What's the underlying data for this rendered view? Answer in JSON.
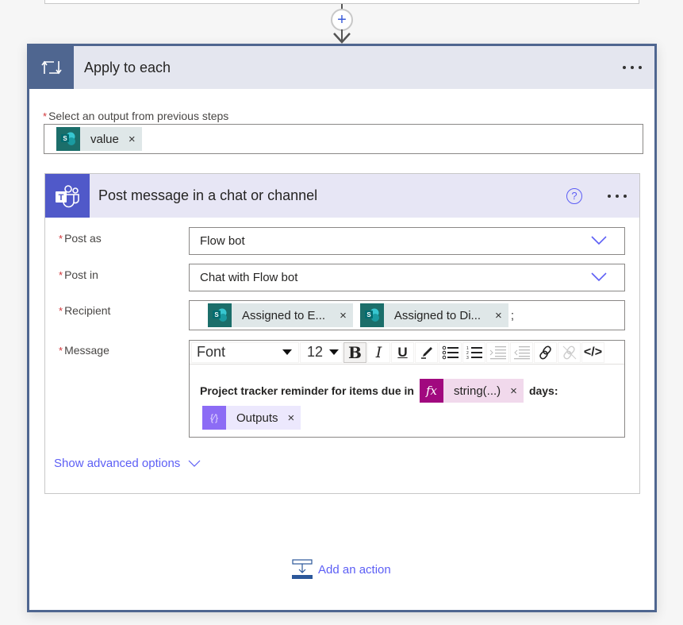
{
  "connector": {
    "add_step_icon": "plus-icon",
    "arrow_icon": "arrow-down-icon"
  },
  "apply_to_each": {
    "title": "Apply to each",
    "icon": "loop-icon",
    "menu_icon": "more-options-icon",
    "output_label": "Select an output from previous steps",
    "required_marker": "*",
    "output_token": {
      "label": "value",
      "icon": "sharepoint-icon",
      "remove": "×"
    }
  },
  "teams_action": {
    "title": "Post message in a chat or channel",
    "icon": "teams-icon",
    "help_icon": "?",
    "fields": {
      "post_as": {
        "label": "Post as",
        "value": "Flow bot"
      },
      "post_in": {
        "label": "Post in",
        "value": "Chat with Flow bot"
      },
      "recipient": {
        "label": "Recipient",
        "tokens": [
          {
            "label": "Assigned to E...",
            "icon": "sharepoint-icon",
            "remove": "×"
          },
          {
            "label": "Assigned to Di...",
            "icon": "sharepoint-icon",
            "remove": "×"
          }
        ],
        "separator": ";"
      },
      "message": {
        "label": "Message",
        "toolbar": {
          "font": "Font",
          "size": "12",
          "bold": "B",
          "italic": "I",
          "underline": "U",
          "code": "</>"
        },
        "text_before": "Project tracker reminder for items due in",
        "expression_token": {
          "label": "string(...)",
          "icon_text": "fx",
          "remove": "×"
        },
        "text_after": "days:",
        "variable_token": {
          "label": "Outputs",
          "icon_text": "{⁄}",
          "remove": "×"
        }
      }
    },
    "advanced_label": "Show advanced options"
  },
  "add_action_label": "Add an action",
  "colors": {
    "loop_header": "#4f6690",
    "teams_brand": "#5059c9",
    "sharepoint": "#1b6e6a",
    "expression": "#a1097f",
    "variable": "#8c6cf5",
    "link": "#5c5ef5",
    "required": "#d13438"
  }
}
